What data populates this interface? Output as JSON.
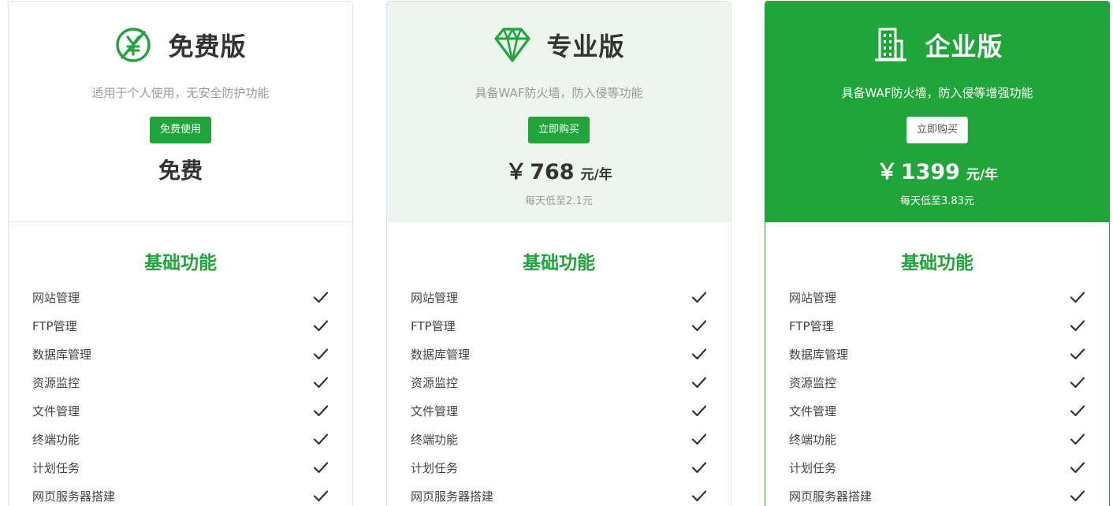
{
  "colors": {
    "accent": "#20a53a",
    "pro_bg": "#ecf5ee",
    "text": "#333333",
    "muted": "#999999"
  },
  "plans": [
    {
      "id": "free",
      "name": "免费版",
      "icon": "no-yen-icon",
      "description": "适用于个人使用，无安全防护功能",
      "button_label": "免费使用",
      "price_text": "免费",
      "section_title": "基础功能",
      "features": [
        "网站管理",
        "FTP管理",
        "数据库管理",
        "资源监控",
        "文件管理",
        "终端功能",
        "计划任务",
        "网页服务器搭建"
      ]
    },
    {
      "id": "pro",
      "name": "专业版",
      "icon": "diamond-icon",
      "description": "具备WAF防火墙，防入侵等功能",
      "button_label": "立即购买",
      "price_currency": "￥",
      "price_amount": "768",
      "price_unit": "元/年",
      "price_note": "每天低至2.1元",
      "section_title": "基础功能",
      "features": [
        "网站管理",
        "FTP管理",
        "数据库管理",
        "资源监控",
        "文件管理",
        "终端功能",
        "计划任务",
        "网页服务器搭建"
      ]
    },
    {
      "id": "ent",
      "name": "企业版",
      "icon": "building-icon",
      "description": "具备WAF防火墙，防入侵等增强功能",
      "button_label": "立即购买",
      "price_currency": "￥",
      "price_amount": "1399",
      "price_unit": "元/年",
      "price_note": "每天低至3.83元",
      "section_title": "基础功能",
      "features": [
        "网站管理",
        "FTP管理",
        "数据库管理",
        "资源监控",
        "文件管理",
        "终端功能",
        "计划任务",
        "网页服务器搭建"
      ]
    }
  ]
}
